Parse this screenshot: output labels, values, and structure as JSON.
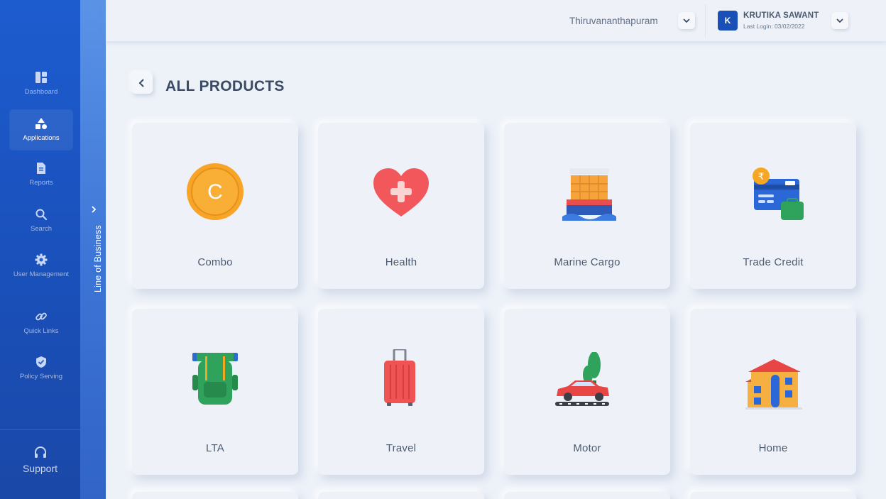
{
  "sidebar": {
    "items": [
      {
        "label": "Dashboard",
        "icon": "dashboard-icon",
        "active": false
      },
      {
        "label": "Applications",
        "icon": "shapes-icon",
        "active": true
      },
      {
        "label": "Reports",
        "icon": "document-icon",
        "active": false
      },
      {
        "label": "Search",
        "icon": "search-icon",
        "active": false
      },
      {
        "label": "User Management",
        "icon": "gear-icon",
        "active": false
      },
      {
        "label": "Quick Links",
        "icon": "link-icon",
        "active": false
      },
      {
        "label": "Policy Serving",
        "icon": "shield-check-icon",
        "active": false
      }
    ],
    "support": {
      "label": "Support",
      "icon": "headset-icon"
    }
  },
  "line_of_business": {
    "label": "Line of Business",
    "icon": "chevron-right-icon"
  },
  "header": {
    "location": "Thiruvananthapuram",
    "user": {
      "initial": "K",
      "name": "KRUTIKA SAWANT",
      "last_login": "Last Login: 03/02/2022"
    }
  },
  "page": {
    "title": "ALL PRODUCTS",
    "back_icon": "chevron-left-icon"
  },
  "products": [
    {
      "label": "Combo",
      "icon": "coin-c-icon"
    },
    {
      "label": "Health",
      "icon": "heart-plus-icon"
    },
    {
      "label": "Marine Cargo",
      "icon": "cargo-ship-icon"
    },
    {
      "label": "Trade Credit",
      "icon": "credit-card-rupee-icon"
    },
    {
      "label": "LTA",
      "icon": "backpack-icon"
    },
    {
      "label": "Travel",
      "icon": "suitcase-icon"
    },
    {
      "label": "Motor",
      "icon": "car-icon"
    },
    {
      "label": "Home",
      "icon": "house-icon"
    }
  ],
  "colors": {
    "sidebar": "#1d5ccf",
    "strip": "#4a82e0",
    "background": "#edf1f8",
    "title": "#3b4b64",
    "avatar": "#1a4fb8"
  }
}
